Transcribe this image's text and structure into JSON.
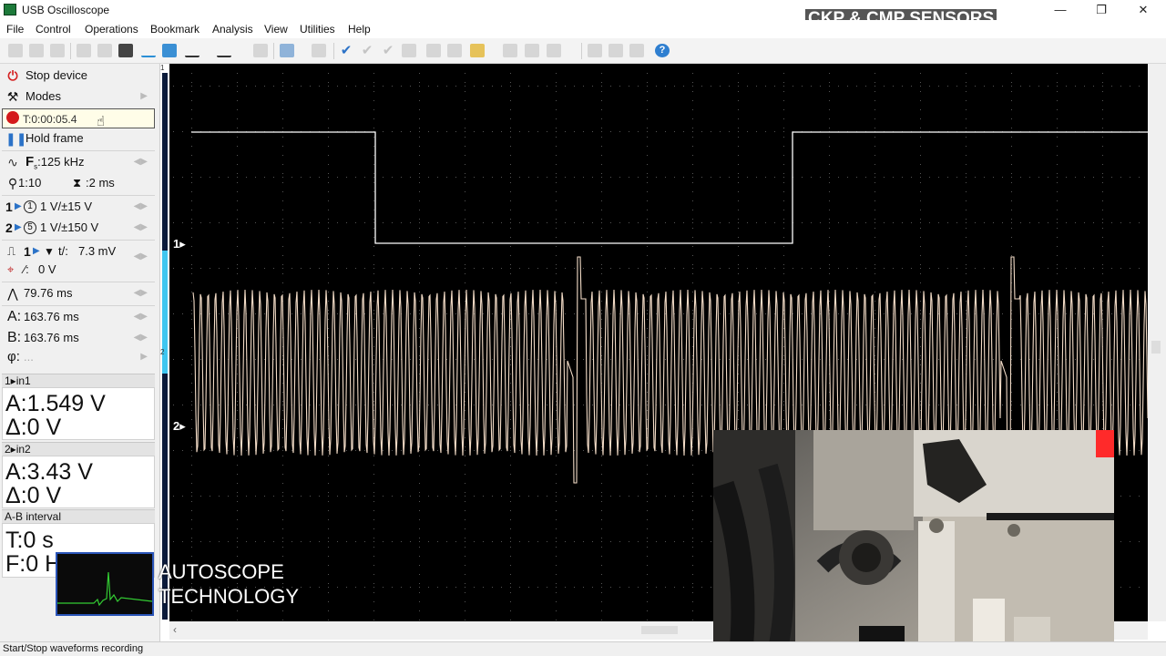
{
  "window": {
    "title": "USB Oscilloscope",
    "overlay_title": "CKP & CMP SENSORS",
    "minimize": "—",
    "maximize": "❐",
    "close": "✕"
  },
  "menu": [
    "File",
    "Control",
    "Operations",
    "Bookmark",
    "Analysis",
    "View",
    "Utilities",
    "Help"
  ],
  "side": {
    "stop_device": "Stop device",
    "modes": "Modes",
    "record_time": "T:0:00:05.4",
    "hold_frame": "Hold frame",
    "sample_rate": "125 kHz",
    "sample_prefix": "F",
    "zoom": "1:10",
    "timebase": "2 ms",
    "ch1_label": "1",
    "ch1_range": "1 V/±15 V",
    "ch2_label": "2",
    "ch2_range": "1 V/±150 V",
    "trig_ch": "1",
    "trig_level": "7.3 mV",
    "trig_level_prefix": "t/:",
    "trig_offset": "0 V",
    "period": "79.76 ms",
    "cursor_a_label": "A:",
    "cursor_a": "163.76 ms",
    "cursor_b_label": "B:",
    "cursor_b": "163.76 ms",
    "phi_label": "φ:",
    "phi_value": "..."
  },
  "groups": {
    "in1_header": "1▸in1",
    "in1_a": "A:1.549 V",
    "in1_delta": "Δ:0 V",
    "in2_header": "2▸in2",
    "in2_a": "A:3.43 V",
    "in2_delta": "Δ:0 V",
    "ab_header": "A-B interval",
    "ab_t": "T:0 s",
    "ab_f": "F:0 Hz"
  },
  "scope": {
    "ch1_marker": "1▸",
    "ch2_marker": "2▸",
    "ch1_color": "#ffffff",
    "ch2_color": "#f3dcc7",
    "grid_color": "#555555",
    "background": "#000000",
    "strip_label_1": "1",
    "strip_label_2": "2"
  },
  "brand": {
    "line1": "AUTOSCOPE",
    "line2": "TECHNOLOGY"
  },
  "status": {
    "text": "Start/Stop waveforms recording"
  },
  "icons": {
    "stop": "power-icon",
    "modes": "modes-icon",
    "hold": "pause-icon",
    "help": "?"
  }
}
